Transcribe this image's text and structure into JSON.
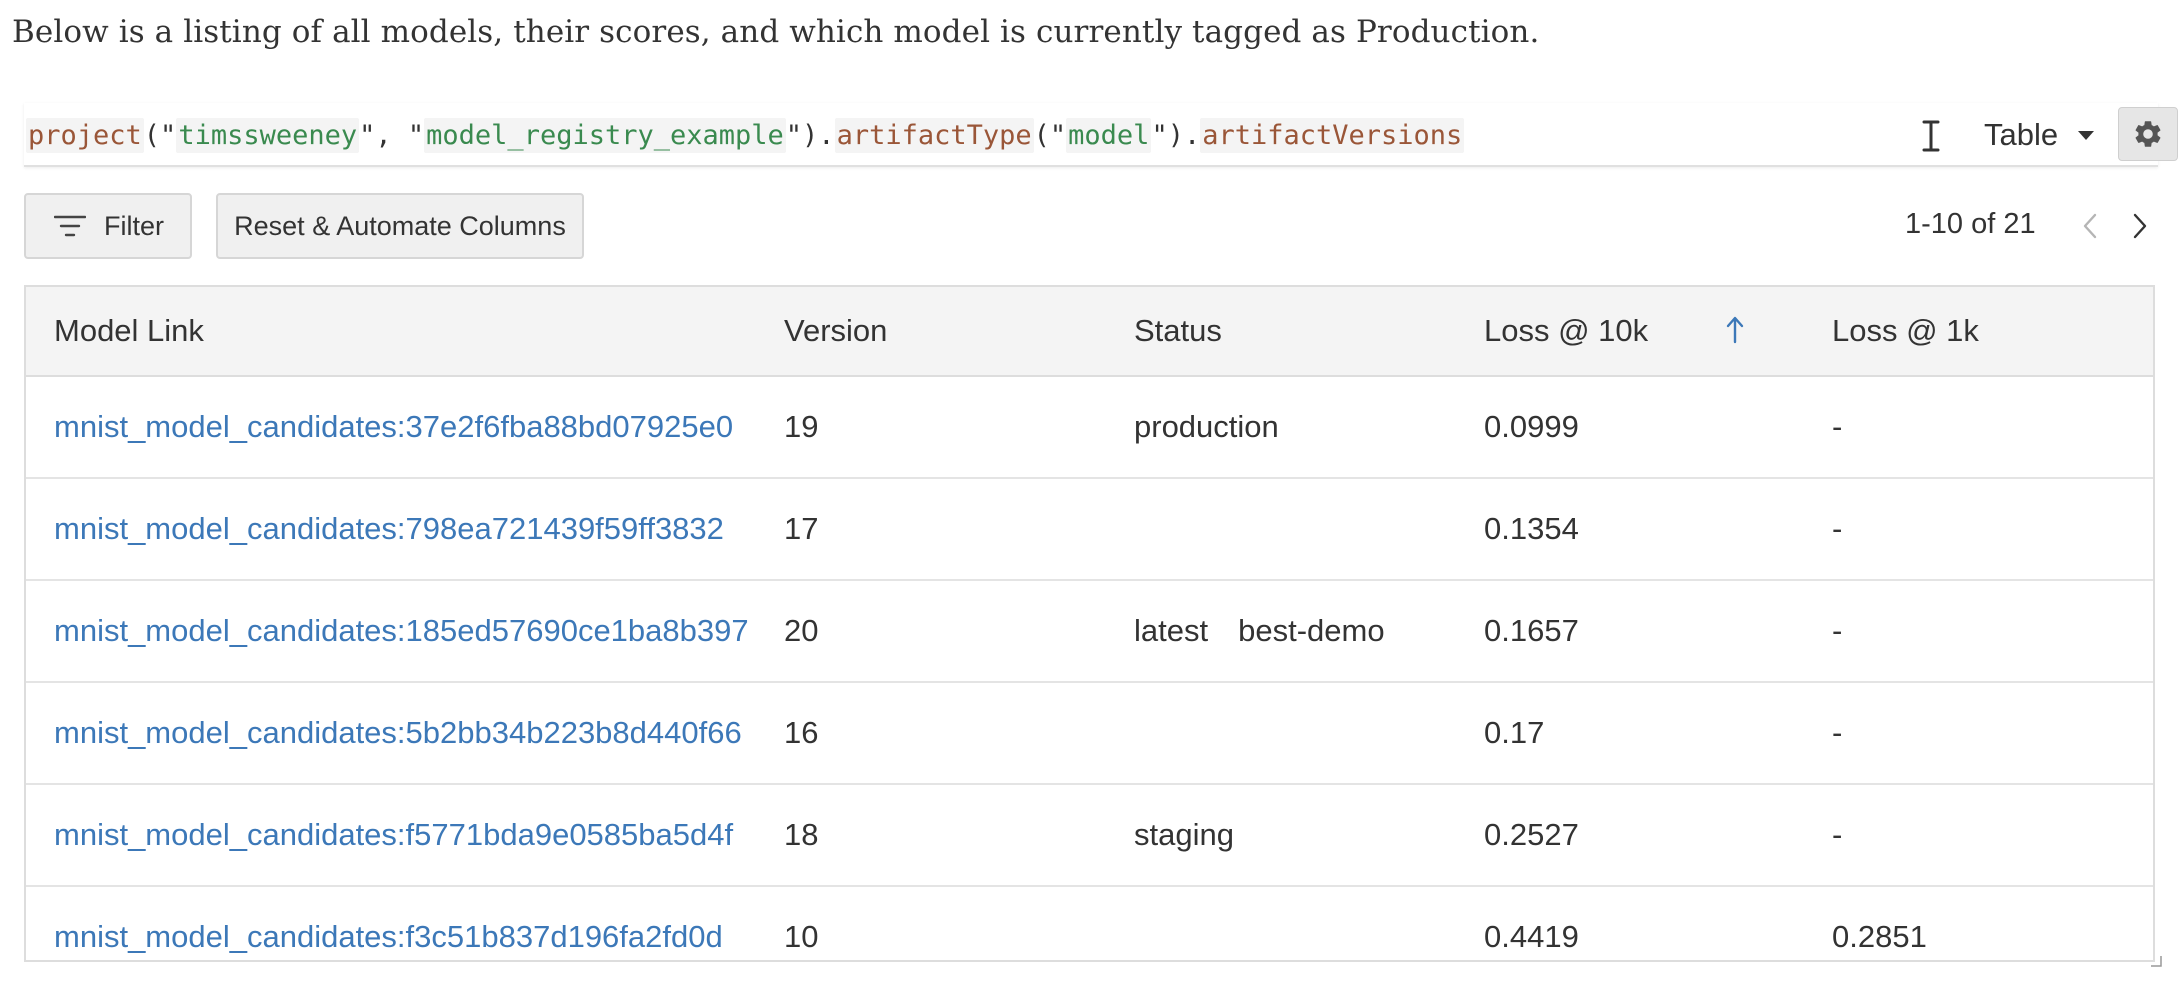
{
  "intro": "Below is a listing of all models, their scores, and which model is currently tagged as Production.",
  "query": {
    "tokens": [
      {
        "text": "project",
        "kind": "fn"
      },
      {
        "text": "(\"",
        "kind": "punct"
      },
      {
        "text": "timssweeney",
        "kind": "str"
      },
      {
        "text": "\", \"",
        "kind": "punct"
      },
      {
        "text": "model_registry_example",
        "kind": "str"
      },
      {
        "text": "\").",
        "kind": "punct"
      },
      {
        "text": "artifactType",
        "kind": "fn"
      },
      {
        "text": "(\"",
        "kind": "punct"
      },
      {
        "text": "model",
        "kind": "str"
      },
      {
        "text": "\").",
        "kind": "punct"
      },
      {
        "text": "artifactVersions",
        "kind": "fn"
      }
    ],
    "view_mode": "Table",
    "icons": {
      "cursor": "text-cursor-icon",
      "settings": "gear-icon",
      "dropdown": "caret-down-icon"
    }
  },
  "toolbar": {
    "filter_label": "Filter",
    "reset_label": "Reset & Automate Columns",
    "pagination": "1-10 of 21"
  },
  "table": {
    "columns": [
      "Model Link",
      "Version",
      "Status",
      "Loss @ 10k",
      "Loss @ 1k"
    ],
    "sorted_column": "Loss @ 10k",
    "sort_direction": "ascending",
    "rows": [
      {
        "model_link": "mnist_model_candidates:37e2f6fba88bd07925e0",
        "version": "19",
        "status": [
          "production"
        ],
        "loss_10k": "0.0999",
        "loss_1k": "-"
      },
      {
        "model_link": "mnist_model_candidates:798ea721439f59ff3832",
        "version": "17",
        "status": [],
        "loss_10k": "0.1354",
        "loss_1k": "-"
      },
      {
        "model_link": "mnist_model_candidates:185ed57690ce1ba8b397",
        "version": "20",
        "status": [
          "latest",
          "best-demo"
        ],
        "loss_10k": "0.1657",
        "loss_1k": "-"
      },
      {
        "model_link": "mnist_model_candidates:5b2bb34b223b8d440f66",
        "version": "16",
        "status": [],
        "loss_10k": "0.17",
        "loss_1k": "-"
      },
      {
        "model_link": "mnist_model_candidates:f5771bda9e0585ba5d4f",
        "version": "18",
        "status": [
          "staging"
        ],
        "loss_10k": "0.2527",
        "loss_1k": "-"
      },
      {
        "model_link": "mnist_model_candidates:f3c51b837d196fa2fd0d",
        "version": "10",
        "status": [],
        "loss_10k": "0.4419",
        "loss_1k": "0.2851"
      }
    ]
  },
  "colors": {
    "link": "#3c78b8",
    "function_token": "#9a5638",
    "string_token": "#3a8a4f",
    "header_bg": "#f4f4f4",
    "sort_arrow": "#3c78b8"
  }
}
